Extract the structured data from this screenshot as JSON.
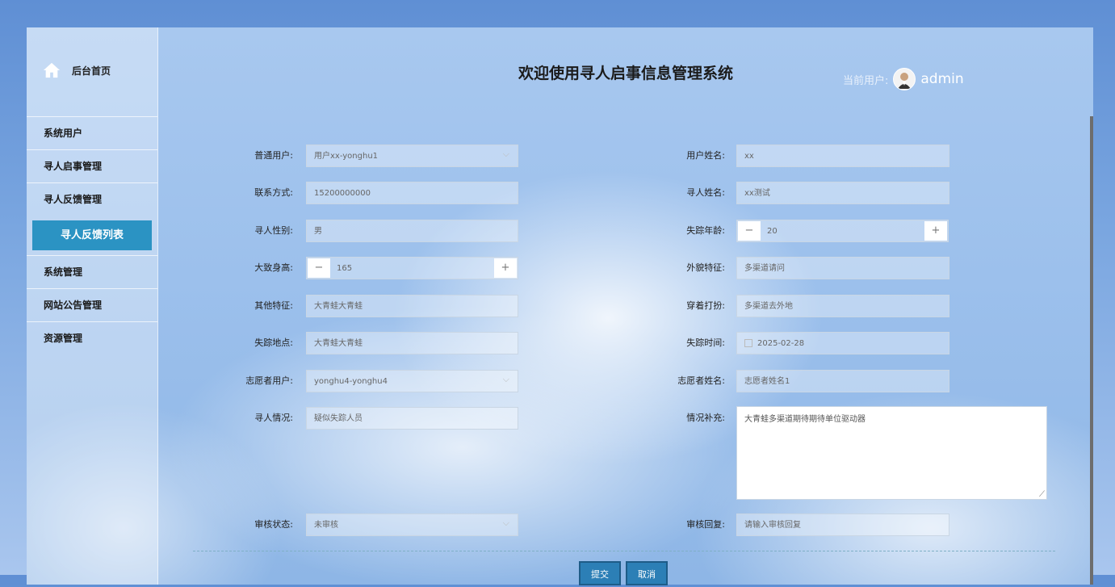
{
  "header": {
    "title": "欢迎使用寻人启事信息管理系统",
    "user_label": "当前用户:",
    "username": "admin"
  },
  "sidebar": {
    "home_label": "后台首页",
    "items": [
      {
        "label": "系统用户"
      },
      {
        "label": "寻人启事管理"
      },
      {
        "label": "寻人反馈管理"
      },
      {
        "label": "寻人反馈列表",
        "active": true
      },
      {
        "label": "系统管理"
      },
      {
        "label": "网站公告管理"
      },
      {
        "label": "资源管理"
      }
    ]
  },
  "form": {
    "ordinary_user": {
      "label": "普通用户:",
      "value": "用户xx-yonghu1"
    },
    "user_name": {
      "label": "用户姓名:",
      "value": "xx"
    },
    "contact": {
      "label": "联系方式:",
      "value": "15200000000"
    },
    "seek_name": {
      "label": "寻人姓名:",
      "value": "xx测试"
    },
    "seek_gender": {
      "label": "寻人性别:",
      "value": "男"
    },
    "missing_age": {
      "label": "失踪年龄:",
      "value": "20",
      "minus": "−",
      "plus": "+"
    },
    "height": {
      "label": "大致身高:",
      "value": "165",
      "minus": "−",
      "plus": "+"
    },
    "appearance": {
      "label": "外貌特征:",
      "value": "多渠道请问"
    },
    "other_features": {
      "label": "其他特征:",
      "value": "大青蛙大青蛙"
    },
    "clothing": {
      "label": "穿着打扮:",
      "value": "多渠道去外地"
    },
    "missing_place": {
      "label": "失踪地点:",
      "value": "大青蛙大青蛙"
    },
    "missing_time": {
      "label": "失踪时间:",
      "value": "2025-02-28"
    },
    "volunteer_user": {
      "label": "志愿者用户:",
      "value": "yonghu4-yonghu4"
    },
    "volunteer_name": {
      "label": "志愿者姓名:",
      "value": "志愿者姓名1"
    },
    "situation": {
      "label": "寻人情况:",
      "value": "疑似失踪人员"
    },
    "supplement": {
      "label": "情况补充:",
      "value": "大青蛙多渠道期待期待单位驱动器"
    },
    "review_status": {
      "label": "审核状态:",
      "value": "未审核"
    },
    "review_reply": {
      "label": "审核回复:",
      "placeholder": "请输入审核回复"
    }
  },
  "buttons": {
    "submit": "提交",
    "cancel": "取消"
  }
}
